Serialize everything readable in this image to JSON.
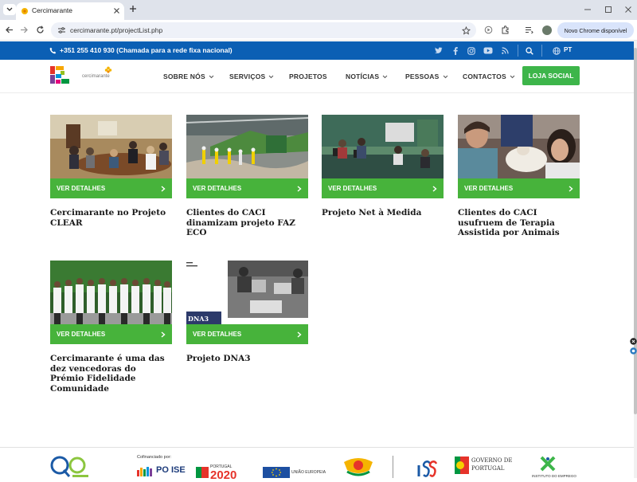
{
  "browser": {
    "tab_title": "Cercimarante",
    "url": "cercimarante.pt/projectList.php",
    "update_label": "Novo Chrome disponível"
  },
  "topbar": {
    "phone": "+351 255 410 930 (Chamada para a rede fixa nacional)",
    "language": "PT",
    "social_icons": [
      "twitter-icon",
      "facebook-icon",
      "instagram-icon",
      "youtube-icon",
      "rss-icon",
      "search-icon",
      "globe-icon"
    ]
  },
  "header": {
    "logo_name": "cercimarante",
    "menu": [
      {
        "label": "SOBRE NÓS",
        "dropdown": true
      },
      {
        "label": "SERVIÇOS",
        "dropdown": true
      },
      {
        "label": "PROJETOS",
        "dropdown": false
      },
      {
        "label": "NOTÍCIAS",
        "dropdown": true
      },
      {
        "label": "PESSOAS",
        "dropdown": true
      },
      {
        "label": "CONTACTOS",
        "dropdown": true
      }
    ],
    "shop_button": "LOJA SOCIAL"
  },
  "projects": [
    {
      "title": "Cercimarante no Projeto CLEAR",
      "cta": "VER DETALHES"
    },
    {
      "title": "Clientes do CACI dinamizam projeto FAZ ECO",
      "cta": "VER DETALHES"
    },
    {
      "title": "Projeto Net à Medida",
      "cta": "VER DETALHES"
    },
    {
      "title": "Clientes do CACI usufruem de Terapia Assistida por Animais",
      "cta": "VER DETALHES"
    },
    {
      "title": "Cercimarante é uma das dez vencedoras do Prémio Fidelidade Comunidade",
      "cta": "VER DETALHES"
    },
    {
      "title": "Projeto DNA3",
      "cta": "VER DETALHES",
      "image_caption": "DNA3"
    }
  ],
  "footer": {
    "cofinanced_label": "Cofinanciado por:",
    "poise_label": "PO ISE",
    "portugal2020_label": "PORTUGAL",
    "portugal2020_year": "2020",
    "eu_label": "UNIÃO EUROPEIA",
    "gov_label_1": "GOVERNO DE",
    "gov_label_2": "PORTUGAL",
    "iefp_label": "INSTITUTO DO EMPREGO"
  },
  "colors": {
    "topbar_blue": "#0b5fb4",
    "accent_green": "#47b33b",
    "shop_green": "#3db54a"
  }
}
